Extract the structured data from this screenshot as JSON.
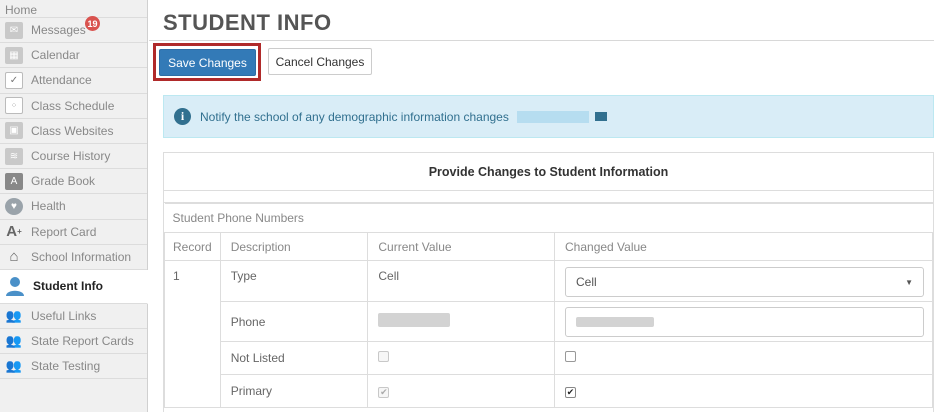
{
  "sidebar": {
    "home_label": "Home",
    "messages_badge": "19",
    "items": [
      {
        "label": "Messages",
        "icon": "message-icon"
      },
      {
        "label": "Calendar",
        "icon": "calendar-icon"
      },
      {
        "label": "Attendance",
        "icon": "attendance-icon"
      },
      {
        "label": "Class Schedule",
        "icon": "schedule-icon"
      },
      {
        "label": "Class Websites",
        "icon": "websites-icon"
      },
      {
        "label": "Course History",
        "icon": "course-history-icon"
      },
      {
        "label": "Grade Book",
        "icon": "gradebook-icon"
      },
      {
        "label": "Health",
        "icon": "health-icon"
      },
      {
        "label": "Report Card",
        "icon": "report-card-icon"
      },
      {
        "label": "School Information",
        "icon": "school-icon"
      },
      {
        "label": "Student Info",
        "icon": "student-icon"
      },
      {
        "label": "Useful Links",
        "icon": "links-icon"
      },
      {
        "label": "State Report Cards",
        "icon": "state-report-icon"
      },
      {
        "label": "State Testing",
        "icon": "state-testing-icon"
      }
    ]
  },
  "page": {
    "title": "STUDENT INFO"
  },
  "toolbar": {
    "save_label": "Save Changes",
    "cancel_label": "Cancel Changes"
  },
  "alert": {
    "text": "Notify the school of any demographic information changes"
  },
  "panel": {
    "heading": "Provide Changes to Student Information",
    "section_label": "Student Phone Numbers",
    "columns": [
      "Record",
      "Description",
      "Current Value",
      "Changed Value"
    ],
    "record_number": "1",
    "rows": {
      "type": {
        "description": "Type",
        "current": "Cell",
        "changed": "Cell"
      },
      "phone": {
        "description": "Phone"
      },
      "not_listed": {
        "description": "Not Listed",
        "current_checked": false,
        "changed_checked": false
      },
      "primary": {
        "description": "Primary",
        "current_checked": true,
        "changed_checked": true
      }
    }
  },
  "colors": {
    "primary_button": "#337ab7",
    "highlight_border": "#b02a2a",
    "alert_bg": "#d9edf7",
    "alert_text": "#31708f",
    "badge": "#d9534f"
  }
}
